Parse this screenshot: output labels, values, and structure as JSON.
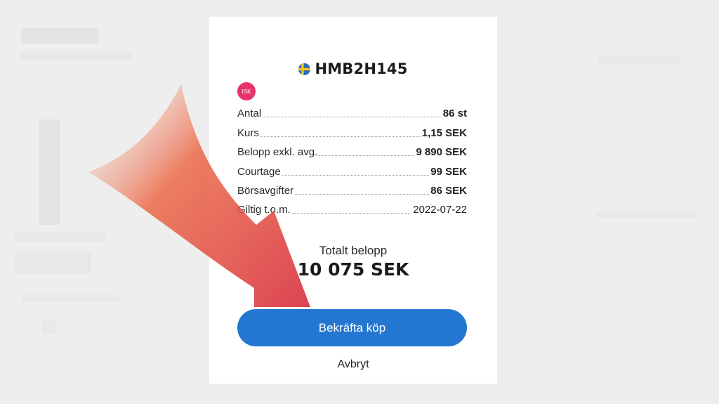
{
  "dialog": {
    "title": "HMB2H145",
    "flag_icon": "sweden-flag-icon",
    "account_badge": "ISK",
    "account_badge_color": "#e8336a",
    "rows": [
      {
        "label": "Antal",
        "value": "86 st"
      },
      {
        "label": "Kurs",
        "value": "1,15 SEK"
      },
      {
        "label": "Belopp exkl. avg.",
        "value": "9 890 SEK"
      },
      {
        "label": "Courtage",
        "value": "99 SEK"
      },
      {
        "label": "Börsavgifter",
        "value": "86 SEK"
      },
      {
        "label": "Giltig t.o.m.",
        "value": "2022-07-22"
      }
    ],
    "total_label": "Totalt belopp",
    "total_value": "10 075 SEK",
    "confirm_label": "Bekräfta köp",
    "confirm_color": "#2477d0",
    "cancel_label": "Avbryt"
  },
  "annotation": {
    "icon": "red-arrow-icon",
    "color": "#e33b3b"
  }
}
